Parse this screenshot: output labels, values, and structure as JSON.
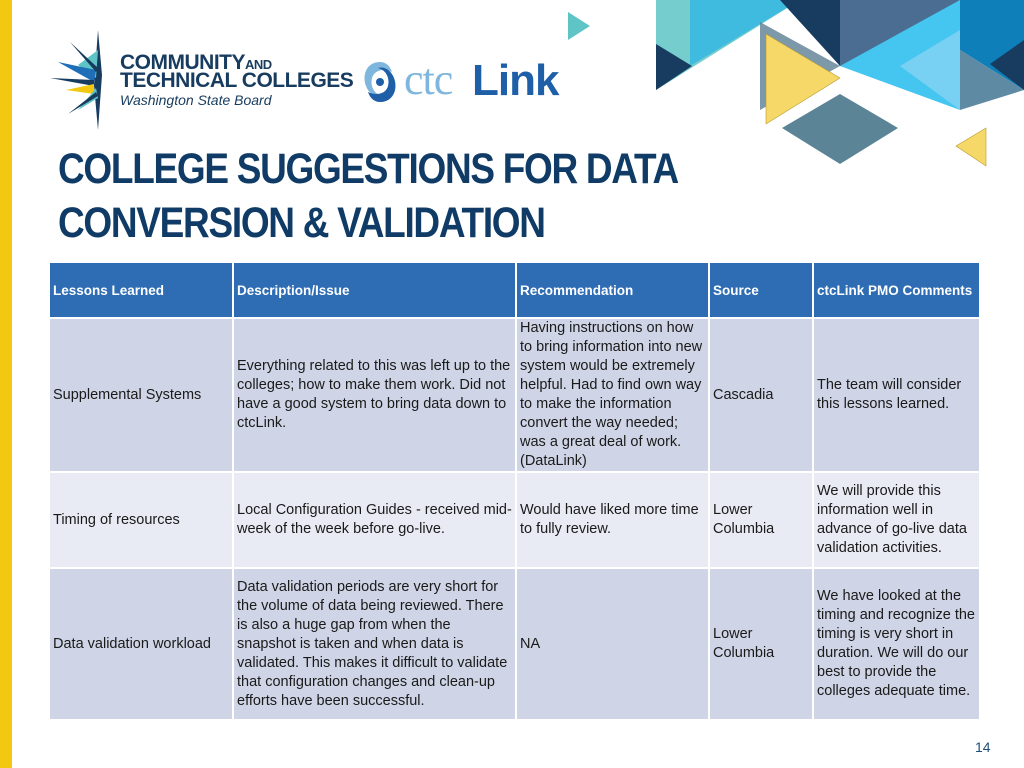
{
  "logos": {
    "ctc": {
      "line1": "COMMUNITY",
      "line1_suffix": "AND",
      "line2": "TECHNICAL COLLEGES",
      "line3": "Washington State Board"
    },
    "ctclink": {
      "part1": "ctc",
      "part2": "Link"
    }
  },
  "colors": {
    "accent_yellow": "#f2c811",
    "title_navy": "#0f3b66",
    "header_blue": "#2e6db4",
    "row_dark": "#cfd5e6",
    "row_light": "#e8ebf4"
  },
  "title": {
    "line1": "COLLEGE SUGGESTIONS FOR DATA",
    "line2": "CONVERSION & VALIDATION"
  },
  "table": {
    "headers": [
      "Lessons Learned",
      "Description/Issue",
      "Recommendation",
      "Source",
      "ctcLink PMO Comments"
    ],
    "rows": [
      {
        "lesson": "Supplemental Systems",
        "description": "Everything related to this was left up to the colleges; how to make them work. Did not have a good system to bring data down to ctcLink.",
        "recommendation": "Having instructions on how to bring information into new system would be extremely helpful. Had to find own way to make the information convert the way needed; was a great deal of work. (DataLink)",
        "source": "Cascadia",
        "comments": "The team will consider this lessons learned."
      },
      {
        "lesson": "Timing of resources",
        "description": "Local Configuration Guides - received mid-week of the week before go-live.",
        "recommendation": "Would have liked more time to fully review.",
        "source": "Lower Columbia",
        "comments": "We will provide this information well in advance of go-live data validation activities."
      },
      {
        "lesson": "Data validation workload",
        "description": "Data validation periods are very short for the volume of data being reviewed. There is also a huge gap from when the snapshot is taken and when data is validated. This makes it difficult to validate that configuration changes and clean-up efforts have been successful.",
        "recommendation": "NA",
        "source": "Lower Columbia",
        "comments": "We have looked at the timing and recognize the timing is very short in duration.  We will do our best to provide the colleges adequate time."
      }
    ]
  },
  "footer": {
    "page_number": "14"
  }
}
